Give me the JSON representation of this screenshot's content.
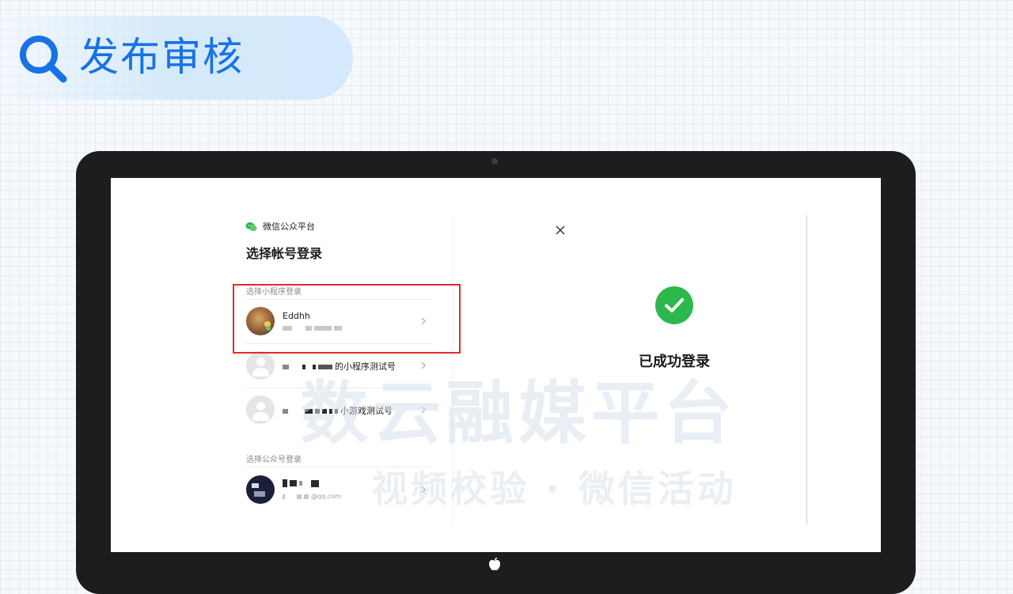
{
  "header": {
    "title": "发布审核"
  },
  "watermark": {
    "line1": "数云融媒平台",
    "line2": "视频校验 · 微信活动"
  },
  "login": {
    "brand": "微信公众平台",
    "title": "选择帐号登录",
    "miniprogram_section": "选择小程序登录",
    "official_section": "选择公众号登录",
    "accounts": [
      {
        "name": "Eddhh"
      },
      {
        "name_suffix": "的小程序测试号"
      },
      {
        "name_suffix": "小游戏测试号"
      },
      {
        "email_suffix": "@qq.com"
      }
    ]
  },
  "success": {
    "message": "已成功登录"
  },
  "colors": {
    "accent": "#1772e6",
    "success": "#2db84d",
    "highlight": "#e02a2a"
  }
}
